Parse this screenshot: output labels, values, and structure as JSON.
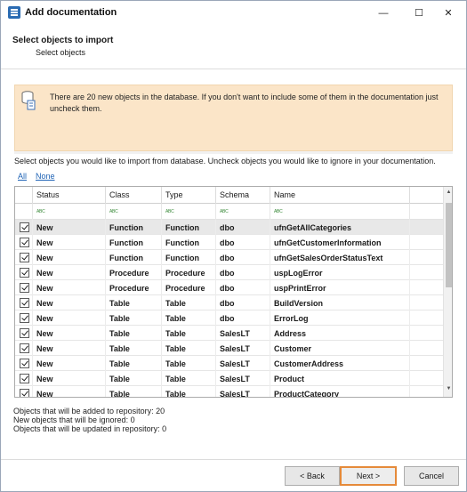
{
  "window": {
    "title": "Add documentation"
  },
  "titlebar": {
    "minimize": "—",
    "maximize": "☐",
    "close": "✕"
  },
  "header": {
    "title": "Select objects to import",
    "subtitle": "Select objects"
  },
  "info": {
    "message": "There are 20 new objects in the database. If you don't want to include some of them in the documentation just uncheck them."
  },
  "instructions": "Select objects you would like to import from database. Uncheck objects you would like to ignore in your documentation.",
  "links": {
    "all": "All",
    "none": "None"
  },
  "grid": {
    "columns": [
      "Status",
      "Class",
      "Type",
      "Schema",
      "Name"
    ],
    "filter_icon_text": "ABC",
    "rows": [
      {
        "checked": true,
        "status": "New",
        "class": "Function",
        "type": "Function",
        "schema": "dbo",
        "name": "ufnGetAllCategories",
        "selected": true
      },
      {
        "checked": true,
        "status": "New",
        "class": "Function",
        "type": "Function",
        "schema": "dbo",
        "name": "ufnGetCustomerInformation"
      },
      {
        "checked": true,
        "status": "New",
        "class": "Function",
        "type": "Function",
        "schema": "dbo",
        "name": "ufnGetSalesOrderStatusText"
      },
      {
        "checked": true,
        "status": "New",
        "class": "Procedure",
        "type": "Procedure",
        "schema": "dbo",
        "name": "uspLogError"
      },
      {
        "checked": true,
        "status": "New",
        "class": "Procedure",
        "type": "Procedure",
        "schema": "dbo",
        "name": "uspPrintError"
      },
      {
        "checked": true,
        "status": "New",
        "class": "Table",
        "type": "Table",
        "schema": "dbo",
        "name": "BuildVersion"
      },
      {
        "checked": true,
        "status": "New",
        "class": "Table",
        "type": "Table",
        "schema": "dbo",
        "name": "ErrorLog"
      },
      {
        "checked": true,
        "status": "New",
        "class": "Table",
        "type": "Table",
        "schema": "SalesLT",
        "name": "Address"
      },
      {
        "checked": true,
        "status": "New",
        "class": "Table",
        "type": "Table",
        "schema": "SalesLT",
        "name": "Customer"
      },
      {
        "checked": true,
        "status": "New",
        "class": "Table",
        "type": "Table",
        "schema": "SalesLT",
        "name": "CustomerAddress"
      },
      {
        "checked": true,
        "status": "New",
        "class": "Table",
        "type": "Table",
        "schema": "SalesLT",
        "name": "Product"
      },
      {
        "checked": true,
        "status": "New",
        "class": "Table",
        "type": "Table",
        "schema": "SalesLT",
        "name": "ProductCategory"
      }
    ]
  },
  "stats": [
    "Objects that will be added to repository: 20",
    "New objects that will be ignored: 0",
    "Objects that will be updated in repository: 0"
  ],
  "buttons": {
    "back": "< Back",
    "next": "Next >",
    "cancel": "Cancel"
  },
  "colors": {
    "info_bg": "#fbe5c8",
    "link": "#1f63b5",
    "next_border": "#e58a3a"
  }
}
